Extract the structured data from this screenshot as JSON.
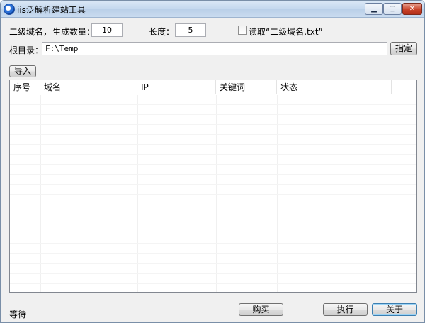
{
  "window": {
    "title": "iis泛解析建站工具",
    "controls": {
      "minimize": "▁",
      "maximize": "▢",
      "close": "✕"
    }
  },
  "form": {
    "subdomain_label": "二级域名，",
    "count_label": "生成数量：",
    "count_value": "10",
    "length_label": "长度：",
    "length_value": "5",
    "read_file_label": "读取“二级域名.txt”",
    "read_file_checked": false,
    "root_label": "根目录：",
    "root_value": "F:\\Temp",
    "specify_button": "指定",
    "import_button": "导入"
  },
  "table": {
    "columns": [
      "序号",
      "域名",
      "IP",
      "关键词",
      "状态"
    ],
    "rows": []
  },
  "footer": {
    "status": "等待",
    "buy_button": "购买",
    "execute_button": "执行",
    "close_button": "关于"
  },
  "colors": {
    "title_gradient_top": "#dbe8f6",
    "close_button": "#c9432a",
    "window_bg": "#f0f0f0"
  }
}
